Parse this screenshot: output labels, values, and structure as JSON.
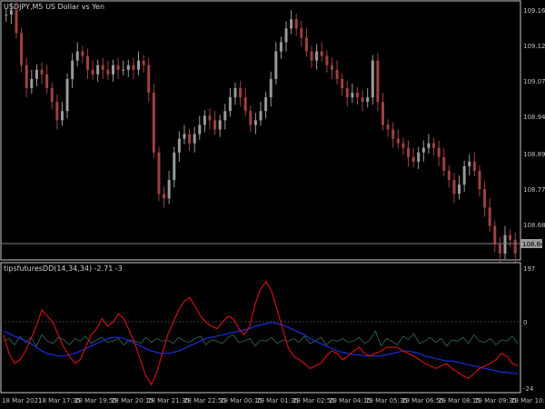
{
  "main_panel": {
    "title": "USDJPY,M5  US Dollar vs Yen",
    "price_labels": [
      "109.165",
      "109.120",
      "109.075",
      "108.940",
      "108.895",
      "108.775",
      "108.685"
    ],
    "current_price_label": "108.644",
    "current_price": 108.644
  },
  "indicator_panel": {
    "title": "tipsfuturesDD(14,34,34) -2.71 -3",
    "scale_labels": [
      "197",
      "0",
      "-24"
    ]
  },
  "time_labels": [
    "18 Mar 2021",
    "18 Mar 17:35",
    "18 Mar 19:55",
    "18 Mar 20:15",
    "18 Mar 21:35",
    "18 Mar 22:55",
    "19 Mar 00:15",
    "19 Mar 01:35",
    "19 Mar 02:55",
    "19 Mar 04:15",
    "19 Mar 05:35",
    "19 Mar 06:55",
    "19 Mar 08:15",
    "19 Mar 09:35",
    "19 Mar 10:55"
  ],
  "colors": {
    "background": "#000000",
    "candle_bull": "#9a9a9a",
    "candle_bear": "#a04040",
    "indicator_red": "#cc1010",
    "indicator_blue": "#1a2ee0",
    "indicator_green": "#2f6f4f",
    "price_line": "#808080"
  },
  "chart_data": {
    "type": "line",
    "series": [
      {
        "values": [
          109.16,
          109.17,
          109.12,
          109.05,
          109.0,
          109.02,
          109.04,
          109.03,
          109.0,
          108.97,
          108.93,
          108.95,
          109.02,
          109.06,
          109.08,
          109.07,
          109.04,
          109.03,
          109.05,
          109.04,
          109.03,
          109.05,
          109.04,
          109.04,
          109.05,
          109.04,
          109.06,
          109.05,
          108.99,
          108.86,
          108.77,
          108.76,
          108.8,
          108.86,
          108.89,
          108.9,
          108.88,
          108.9,
          108.92,
          108.94,
          108.93,
          108.91,
          108.93,
          108.95,
          108.98,
          109.0,
          108.98,
          108.95,
          108.92,
          108.93,
          108.95,
          108.98,
          109.02,
          109.08,
          109.1,
          109.13,
          109.15,
          109.13,
          109.11,
          109.08,
          109.06,
          109.08,
          109.07,
          109.05,
          109.04,
          109.02,
          109.0,
          108.98,
          108.99,
          108.98,
          108.97,
          108.98,
          109.06,
          108.97,
          108.92,
          108.91,
          108.89,
          108.88,
          108.87,
          108.85,
          108.84,
          108.86,
          108.87,
          108.88,
          108.87,
          108.85,
          108.82,
          108.8,
          108.77,
          108.79,
          108.83,
          108.84,
          108.82,
          108.78,
          108.74,
          108.7,
          108.66,
          108.64,
          108.68,
          108.67,
          108.64
        ]
      },
      {
        "name": "red",
        "values": [
          5,
          -10,
          -18,
          -15,
          -8,
          2,
          12,
          25,
          20,
          15,
          5,
          -5,
          -12,
          -18,
          -15,
          -5,
          5,
          10,
          18,
          12,
          15,
          22,
          18,
          8,
          -2,
          -15,
          -28,
          -35,
          -25,
          -10,
          5,
          15,
          25,
          32,
          35,
          28,
          20,
          15,
          12,
          10,
          15,
          20,
          18,
          10,
          5,
          12,
          30,
          42,
          48,
          40,
          25,
          10,
          -5,
          -12,
          -15,
          -18,
          -22,
          -20,
          -18,
          -12,
          -8,
          -10,
          -15,
          -12,
          -8,
          -5,
          -10,
          -12,
          -10,
          -8,
          -5,
          -5,
          -5,
          -8,
          -10,
          -12,
          -15,
          -18,
          -20,
          -22,
          -20,
          -18,
          -22,
          -25,
          -28,
          -30,
          -26,
          -22,
          -20,
          -18,
          -15,
          -10,
          -12,
          -18,
          -20
        ]
      },
      {
        "name": "blue",
        "values": [
          8,
          6,
          4,
          2,
          0,
          -2,
          -5,
          -8,
          -10,
          -11,
          -12,
          -12,
          -11,
          -10,
          -8,
          -6,
          -4,
          -2,
          0,
          2,
          3,
          3,
          2,
          0,
          -2,
          -4,
          -6,
          -8,
          -9,
          -10,
          -10,
          -9,
          -8,
          -6,
          -4,
          -2,
          0,
          2,
          3,
          4,
          5,
          6,
          7,
          8,
          9,
          10,
          12,
          13,
          14,
          15,
          14,
          13,
          11,
          9,
          7,
          5,
          2,
          0,
          -2,
          -4,
          -6,
          -8,
          -9,
          -10,
          -11,
          -11,
          -12,
          -12,
          -12,
          -12,
          -11,
          -10,
          -9,
          -8,
          -8,
          -9,
          -10,
          -12,
          -13,
          -14,
          -15,
          -16,
          -16,
          -17,
          -18,
          -19,
          -20,
          -21,
          -22,
          -23,
          -24,
          -25,
          -25,
          -26,
          -26
        ]
      },
      {
        "name": "green",
        "values": [
          0,
          2,
          -3,
          4,
          -1,
          3,
          -4,
          5,
          0,
          -2,
          3,
          1,
          -3,
          2,
          0,
          4,
          -2,
          1,
          3,
          -1,
          0,
          2,
          -3,
          1,
          0,
          -2,
          3,
          -1,
          2,
          0,
          1,
          -2,
          3,
          0,
          -1,
          2,
          4,
          -3,
          1,
          0,
          -2,
          3,
          5,
          -1,
          0,
          2,
          -4,
          1,
          0,
          3,
          -2,
          1,
          0,
          2,
          -1,
          4,
          -2,
          0,
          3,
          -3,
          1,
          0,
          2,
          -1,
          0,
          3,
          -2,
          1,
          8,
          -4,
          2,
          0,
          -3,
          4,
          1,
          6,
          -2,
          0,
          3,
          -1,
          2,
          -4,
          1,
          0,
          3,
          -2,
          5,
          0,
          -1,
          2,
          -3,
          1,
          0,
          4,
          -2
        ]
      }
    ],
    "ylim_price": [
      108.63,
      109.18
    ],
    "ylim_indicator": [
      -40,
      55
    ]
  }
}
